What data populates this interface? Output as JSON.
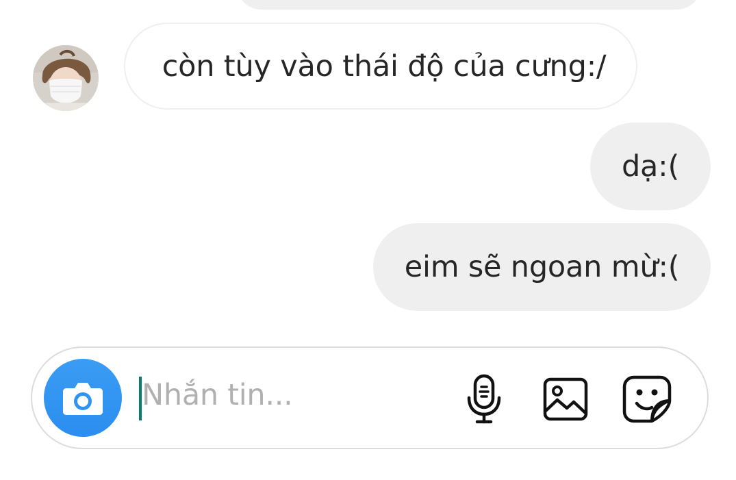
{
  "conversation": {
    "messages": [
      {
        "direction": "sent",
        "text": ""
      },
      {
        "direction": "received",
        "text": "còn tùy vào thái độ của cưng:/"
      },
      {
        "direction": "sent",
        "text": "dạ:("
      },
      {
        "direction": "sent",
        "text": "eim sẽ ngoan mừ:("
      }
    ],
    "sender_avatar": "avatar"
  },
  "composer": {
    "placeholder": "Nhắn tin...",
    "icons": {
      "camera": "camera-icon",
      "mic": "microphone-icon",
      "gallery": "image-gallery-icon",
      "sticker": "sticker-icon"
    }
  },
  "colors": {
    "sent_bubble": "#efefef",
    "camera_button": "#3a9cf3",
    "caret": "#0a7d6e",
    "text": "#262626",
    "placeholder": "#b0b0b0"
  }
}
